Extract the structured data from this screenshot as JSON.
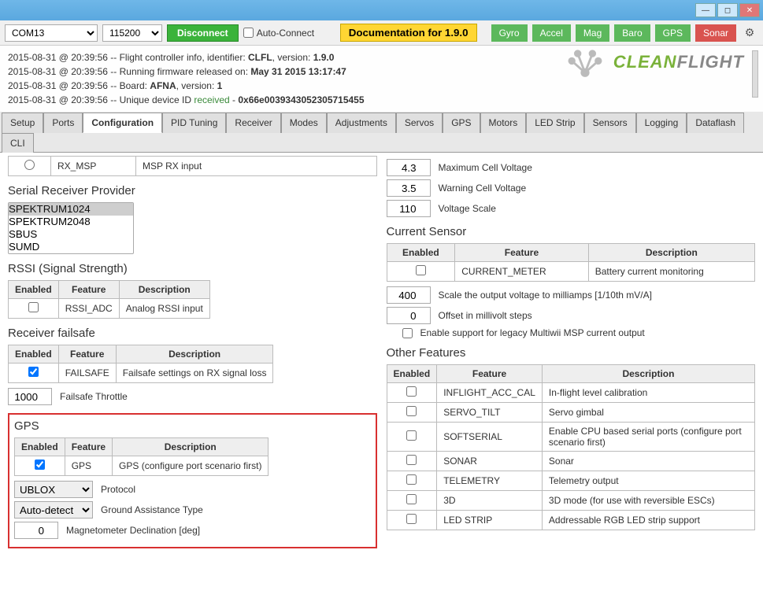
{
  "toolbar": {
    "port": "COM13",
    "baud": "115200",
    "disconnect": "Disconnect",
    "autoconnect": "Auto-Connect",
    "doc": "Documentation for 1.9.0",
    "sensors": [
      "Gyro",
      "Accel",
      "Mag",
      "Baro",
      "GPS",
      "Sonar"
    ]
  },
  "log": {
    "l1a": "2015-08-31 @ 20:39:56 -- Flight controller info, identifier: ",
    "l1b": "CLFL",
    "l1c": ", version: ",
    "l1d": "1.9.0",
    "l2a": "2015-08-31 @ 20:39:56 -- Running firmware released on: ",
    "l2b": "May 31 2015 13:17:47",
    "l3a": "2015-08-31 @ 20:39:56 -- Board: ",
    "l3b": "AFNA",
    "l3c": ", version: ",
    "l3d": "1",
    "l4a": "2015-08-31 @ 20:39:56 -- Unique device ID ",
    "l4b": "received",
    "l4c": " - ",
    "l4d": "0x66e0039343052305715455",
    "brand1": "CLEAN",
    "brand2": "FLIGHT"
  },
  "tabs": [
    "Setup",
    "Ports",
    "Configuration",
    "PID Tuning",
    "Receiver",
    "Modes",
    "Adjustments",
    "Servos",
    "GPS",
    "Motors",
    "LED Strip",
    "Sensors",
    "Logging",
    "Dataflash",
    "CLI"
  ],
  "active_tab": "Configuration",
  "left": {
    "rx_msp_feature": "RX_MSP",
    "rx_msp_desc": "MSP RX input",
    "serial_provider": "Serial Receiver Provider",
    "provider_opts": [
      "SPEKTRUM1024",
      "SPEKTRUM2048",
      "SBUS",
      "SUMD"
    ],
    "rssi_title": "RSSI (Signal Strength)",
    "th_enabled": "Enabled",
    "th_feature": "Feature",
    "th_desc": "Description",
    "rssi_feature": "RSSI_ADC",
    "rssi_desc": "Analog RSSI input",
    "failsafe_title": "Receiver failsafe",
    "failsafe_feature": "FAILSAFE",
    "failsafe_desc": "Failsafe settings on RX signal loss",
    "failsafe_throttle": "1000",
    "failsafe_throttle_lbl": "Failsafe Throttle",
    "gps_title": "GPS",
    "gps_feature": "GPS",
    "gps_desc": "GPS (configure port scenario first)",
    "gps_protocol": "UBLOX",
    "gps_protocol_lbl": "Protocol",
    "gps_assist": "Auto-detect",
    "gps_assist_lbl": "Ground Assistance Type",
    "mag_decl": "0",
    "mag_decl_lbl": "Magnetometer Declination [deg]"
  },
  "right": {
    "max_cell": "4.3",
    "max_cell_lbl": "Maximum Cell Voltage",
    "warn_cell": "3.5",
    "warn_cell_lbl": "Warning Cell Voltage",
    "vscale": "110",
    "vscale_lbl": "Voltage Scale",
    "curr_title": "Current Sensor",
    "curr_feature": "CURRENT_METER",
    "curr_desc": "Battery current monitoring",
    "curr_scale": "400",
    "curr_scale_lbl": "Scale the output voltage to milliamps [1/10th mV/A]",
    "curr_offset": "0",
    "curr_offset_lbl": "Offset in millivolt steps",
    "curr_legacy_lbl": "Enable support for legacy Multiwii MSP current output",
    "other_title": "Other Features",
    "th_enabled": "Enabled",
    "th_feature": "Feature",
    "th_desc": "Description",
    "of": [
      {
        "f": "INFLIGHT_ACC_CAL",
        "d": "In-flight level calibration"
      },
      {
        "f": "SERVO_TILT",
        "d": "Servo gimbal"
      },
      {
        "f": "SOFTSERIAL",
        "d": "Enable CPU based serial ports (configure port scenario first)"
      },
      {
        "f": "SONAR",
        "d": "Sonar"
      },
      {
        "f": "TELEMETRY",
        "d": "Telemetry output"
      },
      {
        "f": "3D",
        "d": "3D mode (for use with reversible ESCs)"
      },
      {
        "f": "LED STRIP",
        "d": "Addressable RGB LED strip support"
      }
    ]
  }
}
